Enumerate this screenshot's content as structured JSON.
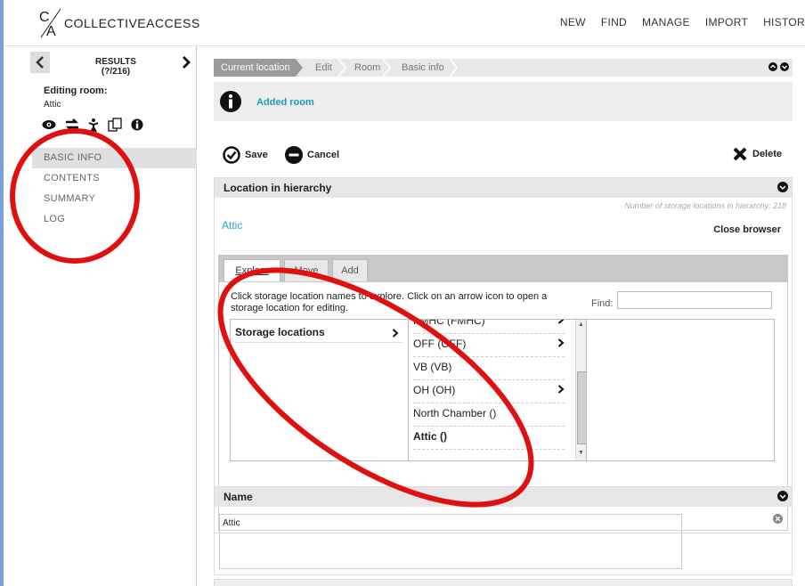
{
  "app": {
    "logo_text": "COLLECTIVEACCESS",
    "nav": [
      "NEW",
      "FIND",
      "MANAGE",
      "IMPORT",
      "HISTOR"
    ]
  },
  "sidebar": {
    "results_label": "RESULTS",
    "results_count": "(?/216)",
    "editing_label": "Editing room:",
    "editing_value": "Attic",
    "menu": [
      {
        "label": "BASIC INFO",
        "active": true
      },
      {
        "label": "CONTENTS",
        "active": false
      },
      {
        "label": "SUMMARY",
        "active": false
      },
      {
        "label": "LOG",
        "active": false
      }
    ]
  },
  "breadcrumb": [
    "Current location",
    "Edit",
    "Room",
    "Basic info"
  ],
  "notice": {
    "text": "Added room"
  },
  "toolbar": {
    "save": "Save",
    "cancel": "Cancel",
    "delete": "Delete"
  },
  "hierarchy": {
    "title": "Location in hierarchy",
    "count_text": "Number of storage locations in hierarchy: 218",
    "current": "Attic",
    "close_browser": "Close browser",
    "tabs": [
      "Explore",
      "Move",
      "Add"
    ],
    "instructions": "Click storage location names to explore. Click on an arrow icon to open a storage location for editing.",
    "find_label": "Find:",
    "root_item": "Storage locations",
    "items": [
      {
        "label": "FMHC (FMHC)",
        "arrow": true
      },
      {
        "label": "OFF (OFF)",
        "arrow": true
      },
      {
        "label": "VB (VB)",
        "arrow": false
      },
      {
        "label": "OH (OH)",
        "arrow": true
      },
      {
        "label": "North Chamber ()",
        "arrow": false
      },
      {
        "label": "Attic ()",
        "arrow": false,
        "bold": true
      }
    ]
  },
  "name_section": {
    "title": "Name",
    "value": "Attic"
  },
  "colors": {
    "accent": "#2aa6c2",
    "annotation": "#e01010"
  }
}
